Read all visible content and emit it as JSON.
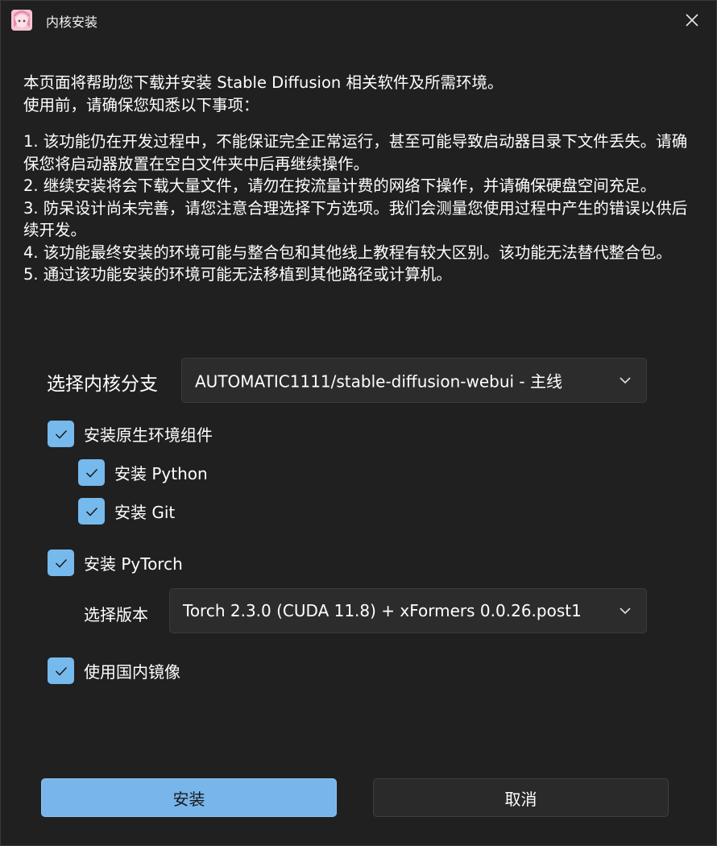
{
  "window": {
    "title": "内核安装",
    "close_icon": "close-icon"
  },
  "intro": {
    "lines_a": [
      "本页面将帮助您下载并安装 Stable Diffusion 相关软件及所需环境。",
      "使用前，请确保您知悉以下事项："
    ],
    "lines_b": [
      "1. 该功能仍在开发过程中，不能保证完全正常运行，甚至可能导致启动器目录下文件丢失。请确保您将启动器放置在空白文件夹中后再继续操作。",
      "2. 继续安装将会下载大量文件，请勿在按流量计费的网络下操作，并请确保硬盘空间充足。",
      "3. 防呆设计尚未完善，请您注意合理选择下方选项。我们会测量您使用过程中产生的错误以供后续开发。",
      "4. 该功能最终安装的环境可能与整合包和其他线上教程有较大区别。该功能无法替代整合包。",
      "5. 通过该功能安装的环境可能无法移植到其他路径或计算机。"
    ]
  },
  "branch": {
    "label": "选择内核分支",
    "value": "AUTOMATIC1111/stable-diffusion-webui - 主线"
  },
  "options": {
    "native_env": {
      "label": "安装原生环境组件",
      "checked": true
    },
    "python": {
      "label": "安装 Python",
      "checked": true
    },
    "git": {
      "label": "安装 Git",
      "checked": true
    },
    "pytorch": {
      "label": "安装 PyTorch",
      "checked": true
    },
    "mirror": {
      "label": "使用国内镜像",
      "checked": true
    }
  },
  "torch": {
    "label": "选择版本",
    "value": "Torch 2.3.0 (CUDA 11.8) + xFormers 0.0.26.post1"
  },
  "buttons": {
    "install": "安装",
    "cancel": "取消"
  },
  "colors": {
    "accent": "#78b5ea",
    "background": "#202020",
    "control": "#2c2c2c"
  }
}
